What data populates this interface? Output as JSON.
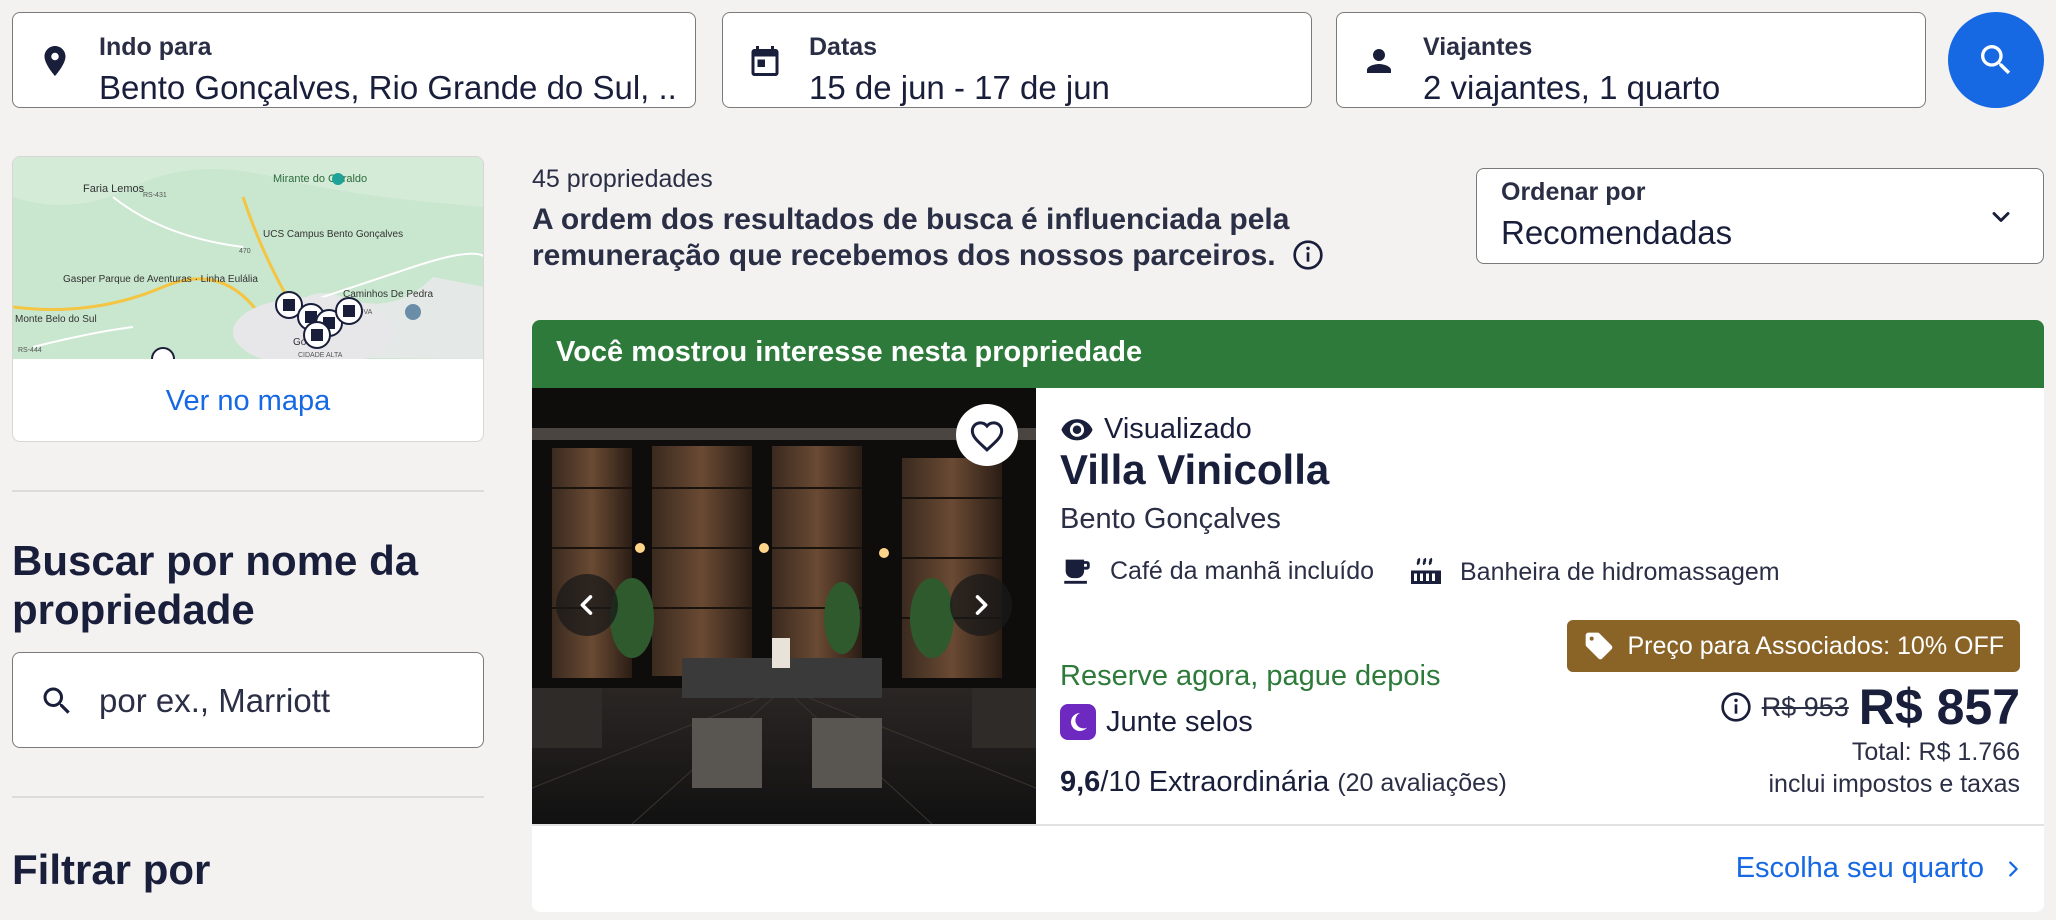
{
  "search": {
    "destination": {
      "label": "Indo para",
      "value": "Bento Gonçalves, Rio Grande do Sul, ..."
    },
    "dates": {
      "label": "Datas",
      "value": "15 de jun - 17 de jun"
    },
    "travelers": {
      "label": "Viajantes",
      "value": "2 viajantes, 1 quarto"
    }
  },
  "map": {
    "link_label": "Ver no mapa",
    "place_labels": [
      "Faria Lemos",
      "Mirante do Geraldo",
      "UCS Campus Bento Gonçalves",
      "Gasper Parque de Aventuras · Linha Eulália",
      "Caminhos De Pedra",
      "Monte Belo do Sul",
      "RS-431",
      "RS-444",
      "470",
      "NOVA",
      "CIDADE ALTA",
      "Go"
    ]
  },
  "name_search": {
    "title": "Buscar por nome da propriedade",
    "placeholder": "por ex., Marriott"
  },
  "filters": {
    "title": "Filtrar por"
  },
  "results": {
    "count": "45 propriedades",
    "disclaimer": "A ordem dos resultados de busca é influenciada pela remuneração que recebemos dos nossos parceiros."
  },
  "sort": {
    "label": "Ordenar por",
    "value": "Recomendadas"
  },
  "property": {
    "banner": "Você mostrou interesse nesta propriedade",
    "viewed_label": "Visualizado",
    "name": "Villa Vinicolla",
    "city": "Bento Gonçalves",
    "amenities": [
      "Café da manhã incluído",
      "Banheira de hidromassagem"
    ],
    "pay_later": "Reserve agora, pague depois",
    "stamps": "Junte selos",
    "rating_score": "9,6",
    "rating_scale": "/10",
    "rating_word": "Extraordinária",
    "rating_count": "(20 avaliações)",
    "member_badge": "Preço para Associados: 10% OFF",
    "old_price": "R$ 953",
    "price": "R$ 857",
    "total": "Total: R$ 1.766",
    "taxes_note": "inclui impostos e taxas",
    "cta": "Escolha seu quarto"
  },
  "colors": {
    "brand_blue": "#1668e3",
    "banner_green": "#2d7a3a",
    "member_gold": "#8a6427",
    "stamp_purple": "#6e2ac0"
  },
  "icons": [
    "location-pin-icon",
    "calendar-icon",
    "person-icon",
    "search-icon",
    "info-icon",
    "chevron-down-icon",
    "heart-icon",
    "chevron-left-icon",
    "chevron-right-icon",
    "eye-icon",
    "coffee-icon",
    "hot-tub-icon",
    "tag-icon",
    "moon-icon"
  ]
}
